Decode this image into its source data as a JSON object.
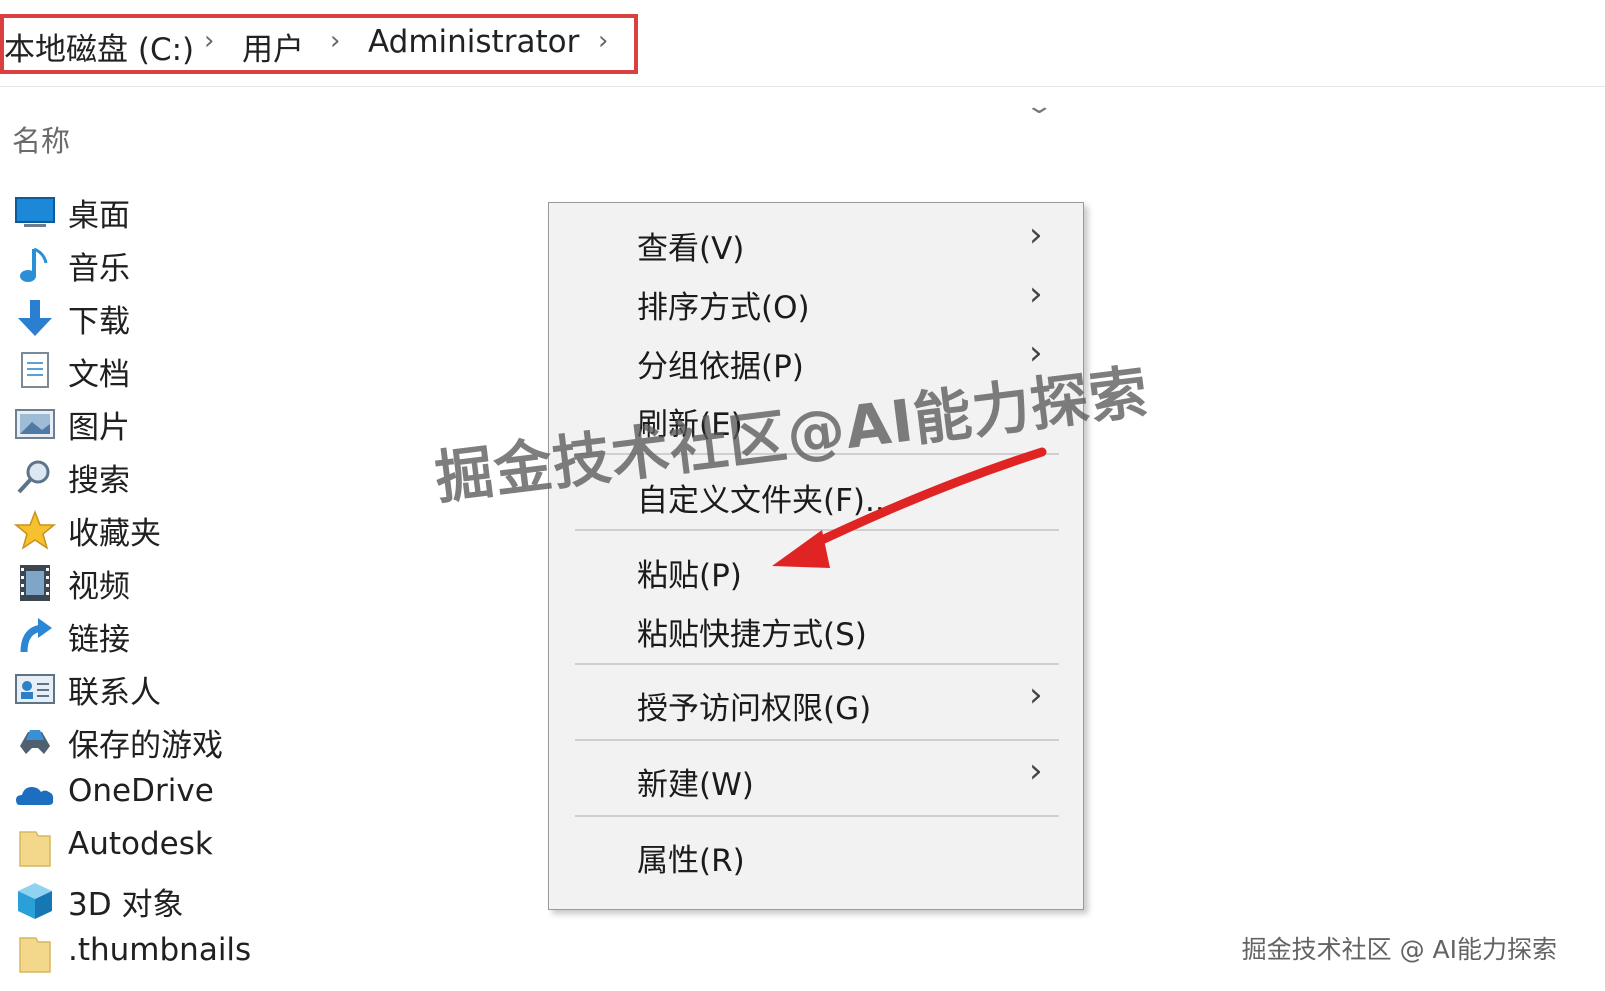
{
  "breadcrumb": {
    "items": [
      "本地磁盘 (C:)",
      "用户",
      "Administrator"
    ],
    "separator": "›"
  },
  "column_header": {
    "name_label": "名称"
  },
  "sidebar": {
    "items": [
      {
        "label": "桌面",
        "icon": "desktop-icon"
      },
      {
        "label": "音乐",
        "icon": "music-icon"
      },
      {
        "label": "下载",
        "icon": "download-icon"
      },
      {
        "label": "文档",
        "icon": "document-icon"
      },
      {
        "label": "图片",
        "icon": "picture-icon"
      },
      {
        "label": "搜索",
        "icon": "search-icon"
      },
      {
        "label": "收藏夹",
        "icon": "star-icon"
      },
      {
        "label": "视频",
        "icon": "video-icon"
      },
      {
        "label": "链接",
        "icon": "link-icon"
      },
      {
        "label": "联系人",
        "icon": "contacts-icon"
      },
      {
        "label": "保存的游戏",
        "icon": "saved-games-icon"
      },
      {
        "label": "OneDrive",
        "icon": "onedrive-icon"
      },
      {
        "label": "Autodesk",
        "icon": "folder-icon"
      },
      {
        "label": "3D 对象",
        "icon": "3d-objects-icon"
      },
      {
        "label": ".thumbnails",
        "icon": "folder-icon"
      }
    ]
  },
  "context_menu": {
    "view": "查看(V)",
    "sort": "排序方式(O)",
    "group": "分组依据(P)",
    "refresh": "刷新(E)",
    "customize": "自定义文件夹(F)...",
    "paste": "粘贴(P)",
    "paste_shortcut": "粘贴快捷方式(S)",
    "give_access": "授予访问权限(G)",
    "new": "新建(W)",
    "properties": "属性(R)",
    "submenu_arrow": "›"
  },
  "watermark": {
    "big": "掘金技术社区@AI能力探索",
    "small": "掘金技术社区 @ AI能力探索"
  },
  "colors": {
    "highlight_border": "#d9403f",
    "arrow": "#e02424",
    "menu_bg": "#f2f2f2"
  }
}
